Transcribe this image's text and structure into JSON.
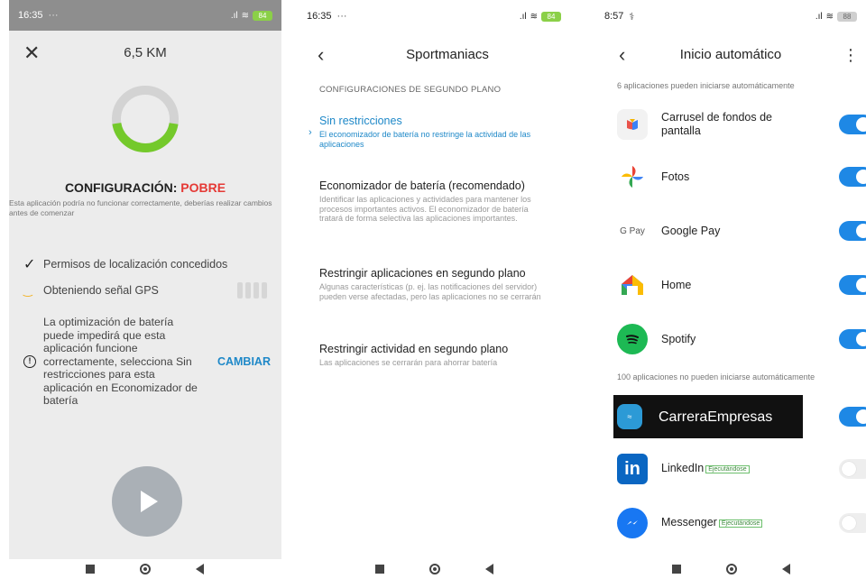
{
  "panel1": {
    "status_time": "16:35",
    "status_dots": "···",
    "battery": "84",
    "title": "6,5 KM",
    "progress_fraction": 0.45,
    "ring_colors": {
      "track": "#d3d3d3",
      "fill": "#74c92b"
    },
    "config_label": "CONFIGURACIÓN:",
    "config_value": "POBRE",
    "config_desc": "Esta aplicación podría no funcionar correctamente, deberías realizar cambios antes de comenzar",
    "location_text": "Permisos de localización concedidos",
    "gps_text": "Obteniendo señal GPS",
    "battery_warning": "La optimización de batería puede impedirá que esta aplicación funcione correctamente, selecciona Sin restricciones para esta aplicación en Economizador de batería",
    "change_label": "CAMBIAR",
    "warning_icon_text": "!"
  },
  "panel2": {
    "status_time": "16:35",
    "status_dots": "···",
    "battery": "84",
    "title": "Sportmaniacs",
    "section_header": "CONFIGURACIONES DE SEGUNDO PLANO",
    "options": [
      {
        "title": "Sin restricciones",
        "desc": "El economizador de batería no restringe la actividad de las aplicaciones"
      },
      {
        "title": "Economizador de batería (recomendado)",
        "desc": "Identificar las aplicaciones y actividades para mantener los procesos importantes activos. El economizador de batería tratará de forma selectiva las aplicaciones importantes."
      },
      {
        "title": "Restringir aplicaciones en segundo plano",
        "desc": "Algunas características (p. ej. las notificaciones del servidor) pueden verse afectadas, pero las aplicaciones no se cerrarán"
      },
      {
        "title": "Restringir actividad en segundo plano",
        "desc": "Las aplicaciones se cerrarán para ahorrar batería"
      }
    ],
    "selected_index": 0
  },
  "panel3": {
    "status_time": "8:57",
    "status_extra": "⚕",
    "battery": "88",
    "title": "Inicio automático",
    "enabled_header": "6 aplicaciones pueden iniciarse automáticamente",
    "disabled_header": "100 aplicaciones no pueden iniciarse automáticamente",
    "apps_enabled": [
      {
        "name": "Carrusel de fondos de pantalla",
        "icon": "wallpaper-carousel-icon",
        "on": true
      },
      {
        "name": "Fotos",
        "icon": "google-photos-icon",
        "on": true
      },
      {
        "name": "Google Pay",
        "icon": "google-pay-icon",
        "icon_text": "G Pay",
        "on": true
      },
      {
        "name": "Home",
        "icon": "google-home-icon",
        "on": true
      },
      {
        "name": "Spotify",
        "icon": "spotify-icon",
        "on": true
      }
    ],
    "apps_disabled": [
      {
        "name": "CarreraEmpresas",
        "icon": "carrera-empresas-icon",
        "on": true
      },
      {
        "name": "LinkedIn",
        "tag": "Ejecutándose",
        "icon": "linkedin-icon",
        "icon_text": "in",
        "on": false
      },
      {
        "name": "Messenger",
        "tag": "Ejecutándose",
        "icon": "messenger-icon",
        "on": false
      }
    ],
    "toggle_color": "#1e88e5"
  }
}
